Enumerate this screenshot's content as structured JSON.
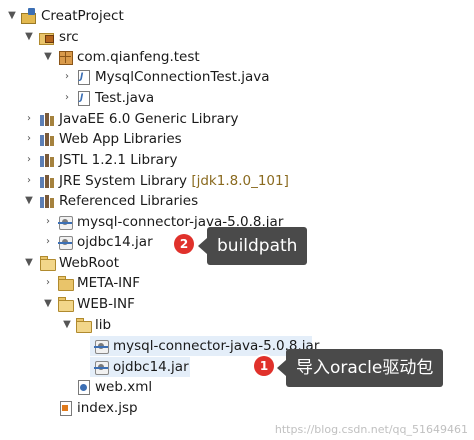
{
  "tree": {
    "project": {
      "label": "CreatProject",
      "icon": "project-icon"
    },
    "src": {
      "label": "src",
      "icon": "source-folder-icon"
    },
    "package": {
      "label": "com.qianfeng.test",
      "icon": "package-icon"
    },
    "file_mysql_test": {
      "label": "MysqlConnectionTest.java",
      "icon": "java-file-icon"
    },
    "file_test": {
      "label": "Test.java",
      "icon": "java-file-icon"
    },
    "lib_javaee": {
      "label": "JavaEE 6.0 Generic Library",
      "icon": "library-icon"
    },
    "lib_webapp": {
      "label": "Web App Libraries",
      "icon": "library-icon"
    },
    "lib_jstl": {
      "label": "JSTL 1.2.1 Library",
      "icon": "library-icon"
    },
    "lib_jre": {
      "label": "JRE System Library",
      "decoration": "[jdk1.8.0_101]",
      "icon": "library-icon"
    },
    "referenced": {
      "label": "Referenced Libraries",
      "icon": "library-icon"
    },
    "ref_mysql_jar": {
      "label": "mysql-connector-java-5.0.8.jar",
      "icon": "jar-icon"
    },
    "ref_ojdbc_jar": {
      "label": "ojdbc14.jar",
      "icon": "jar-icon"
    },
    "webroot": {
      "label": "WebRoot",
      "icon": "folder-icon"
    },
    "metainf": {
      "label": "META-INF",
      "icon": "folder-icon"
    },
    "webinf": {
      "label": "WEB-INF",
      "icon": "folder-icon"
    },
    "lib": {
      "label": "lib",
      "icon": "folder-icon"
    },
    "lib_mysql_jar": {
      "label": "mysql-connector-java-5.0.8.jar",
      "icon": "jar-file-icon"
    },
    "lib_ojdbc_jar": {
      "label": "ojdbc14.jar",
      "icon": "jar-file-icon"
    },
    "webxml": {
      "label": "web.xml",
      "icon": "xml-file-icon"
    },
    "indexjsp": {
      "label": "index.jsp",
      "icon": "jsp-file-icon"
    }
  },
  "annotations": {
    "step2": {
      "number": "2",
      "text": "buildpath"
    },
    "step1": {
      "number": "1",
      "text": "导入oracle驱动包"
    }
  },
  "watermark": "https://blog.csdn.net/qq_51649461",
  "colors": {
    "badge": "#e0312b",
    "callout_bg": "#4a4a4a",
    "selection": "#e4eef9"
  }
}
